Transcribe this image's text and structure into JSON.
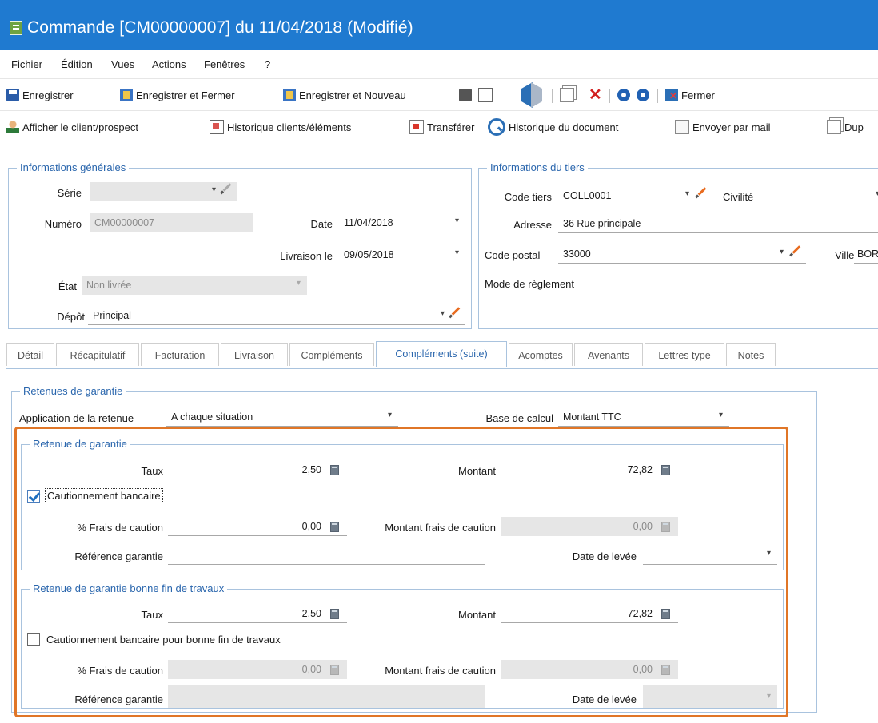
{
  "window": {
    "title": "Commande [CM00000007] du 11/04/2018 (Modifié)"
  },
  "menu": [
    "Fichier",
    "Édition",
    "Vues",
    "Actions",
    "Fenêtres",
    "?"
  ],
  "toolbar1": {
    "save": "Enregistrer",
    "save_close": "Enregistrer et Fermer",
    "save_new": "Enregistrer et Nouveau",
    "close": "Fermer"
  },
  "toolbar2": {
    "show_client": "Afficher le client/prospect",
    "history_clients": "Historique clients/éléments",
    "transfer": "Transférer",
    "doc_history": "Historique du document",
    "send_mail": "Envoyer par mail",
    "dup": "Dup"
  },
  "general": {
    "title": "Informations générales",
    "serie_label": "Série",
    "serie_value": "",
    "numero_label": "Numéro",
    "numero_value": "CM00000007",
    "date_label": "Date",
    "date_value": "11/04/2018",
    "livraison_label": "Livraison le",
    "livraison_value": "09/05/2018",
    "etat_label": "État",
    "etat_value": "Non livrée",
    "depot_label": "Dépôt",
    "depot_value": "Principal"
  },
  "tiers": {
    "title": "Informations du tiers",
    "code_label": "Code tiers",
    "code_value": "COLL0001",
    "civilite_label": "Civilité",
    "civilite_value": "",
    "adresse_label": "Adresse",
    "adresse_value": "36 Rue principale",
    "cp_label": "Code postal",
    "cp_value": "33000",
    "ville_label": "Ville",
    "ville_value": "BOR",
    "reglement_label": "Mode de règlement",
    "reglement_value": ""
  },
  "tabs": [
    "Détail",
    "Récapitulatif",
    "Facturation",
    "Livraison",
    "Compléments",
    "Compléments (suite)",
    "Acomptes",
    "Avenants",
    "Lettres type",
    "Notes"
  ],
  "retenues": {
    "title": "Retenues de garantie",
    "application_label": "Application de la retenue",
    "application_value": "A chaque situation",
    "base_label": "Base de calcul",
    "base_value": "Montant TTC"
  },
  "retenue": {
    "title": "Retenue de garantie",
    "taux_label": "Taux",
    "taux_value": "2,50",
    "montant_label": "Montant",
    "montant_value": "72,82",
    "caution_label": "Cautionnement bancaire",
    "caution_checked": true,
    "frais_label": "% Frais de caution",
    "frais_value": "0,00",
    "montant_frais_label": "Montant frais de caution",
    "montant_frais_value": "0,00",
    "reference_label": "Référence garantie",
    "reference_value": "",
    "levee_label": "Date de levée",
    "levee_value": ""
  },
  "bonnefin": {
    "title": "Retenue de garantie bonne fin de travaux",
    "taux_label": "Taux",
    "taux_value": "2,50",
    "montant_label": "Montant",
    "montant_value": "72,82",
    "caution_label": "Cautionnement bancaire pour bonne fin de travaux",
    "caution_checked": false,
    "frais_label": "% Frais de caution",
    "frais_value": "0,00",
    "montant_frais_label": "Montant frais de caution",
    "montant_frais_value": "0,00",
    "reference_label": "Référence garantie",
    "reference_value": "",
    "levee_label": "Date de levée",
    "levee_value": ""
  }
}
